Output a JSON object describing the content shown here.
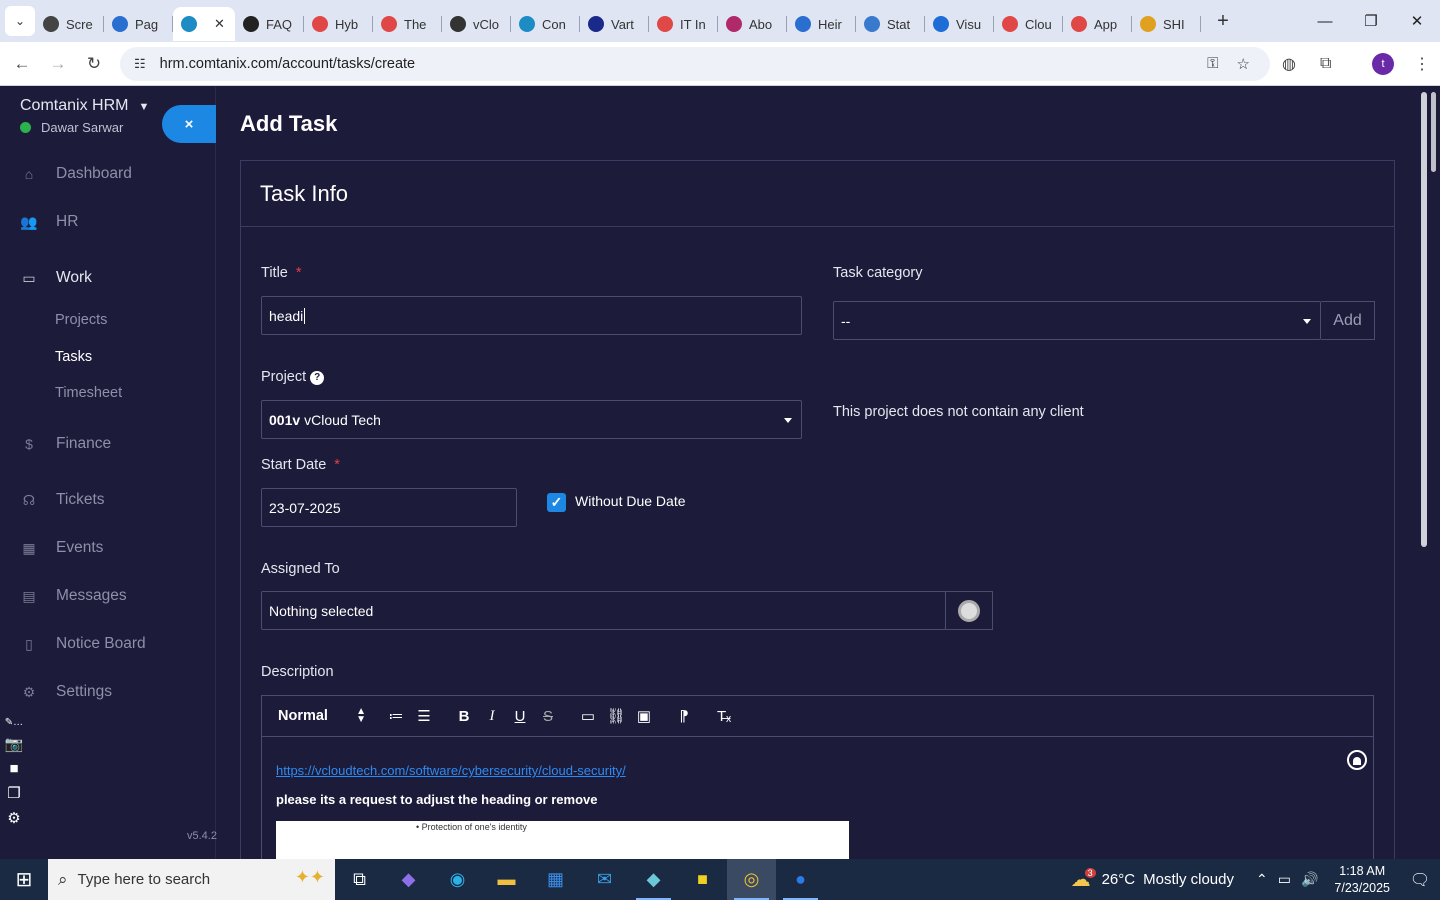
{
  "browser": {
    "tabs": [
      {
        "label": "Scre",
        "color": "#444"
      },
      {
        "label": "Pag",
        "color": "#2a6ed0"
      },
      {
        "label": "",
        "color": "#1e8cc4",
        "active": true
      },
      {
        "label": "FAQ",
        "color": "#222"
      },
      {
        "label": "Hyb",
        "color": "#e04848"
      },
      {
        "label": "The",
        "color": "#e04848"
      },
      {
        "label": "vClo",
        "color": "#333"
      },
      {
        "label": "Con",
        "color": "#1e8cc4"
      },
      {
        "label": "Vart",
        "color": "#1a2a8a"
      },
      {
        "label": "IT In",
        "color": "#e04848"
      },
      {
        "label": "Abo",
        "color": "#b02a6a"
      },
      {
        "label": "Heir",
        "color": "#2a6ed0"
      },
      {
        "label": "Stat",
        "color": "#3a7acc"
      },
      {
        "label": "Visu",
        "color": "#1e6cd6"
      },
      {
        "label": "Clou",
        "color": "#e04848"
      },
      {
        "label": "App",
        "color": "#e04848"
      },
      {
        "label": "SHI",
        "color": "#e0a020"
      }
    ],
    "url": "hrm.comtanix.com/account/tasks/create"
  },
  "sidebar": {
    "brand": "Comtanix HRM",
    "user": "Dawar Sarwar",
    "collapse_label": "×",
    "menu": {
      "dashboard": "Dashboard",
      "hr": "HR",
      "work": "Work",
      "projects": "Projects",
      "tasks": "Tasks",
      "timesheet": "Timesheet",
      "finance": "Finance",
      "tickets": "Tickets",
      "events": "Events",
      "messages": "Messages",
      "notice_board": "Notice Board",
      "settings": "Settings"
    },
    "version": "v5.4.2"
  },
  "page": {
    "title": "Add Task",
    "card_title": "Task Info",
    "title_label": "Title",
    "title_value": "headi",
    "category_label": "Task category",
    "category_value": "--",
    "category_add": "Add",
    "project_label": "Project",
    "project_code": "001v",
    "project_name": "vCloud Tech",
    "project_note": "This project does not contain any client",
    "start_label": "Start Date",
    "start_value": "23-07-2025",
    "without_due_label": "Without Due Date",
    "assigned_label": "Assigned To",
    "assigned_value": "Nothing selected",
    "description_label": "Description",
    "editor": {
      "format": "Normal",
      "link": "https://vcloudtech.com/software/cybersecurity/cloud-security/",
      "text": "please its a request to adjust the heading or remove",
      "image_text": "• Protection of one's identity"
    }
  },
  "taskbar": {
    "search_placeholder": "Type here to search",
    "weather_temp": "26°C",
    "weather_text": "Mostly cloudy",
    "weather_badge": "3",
    "time": "1:18 AM",
    "date": "7/23/2025"
  }
}
